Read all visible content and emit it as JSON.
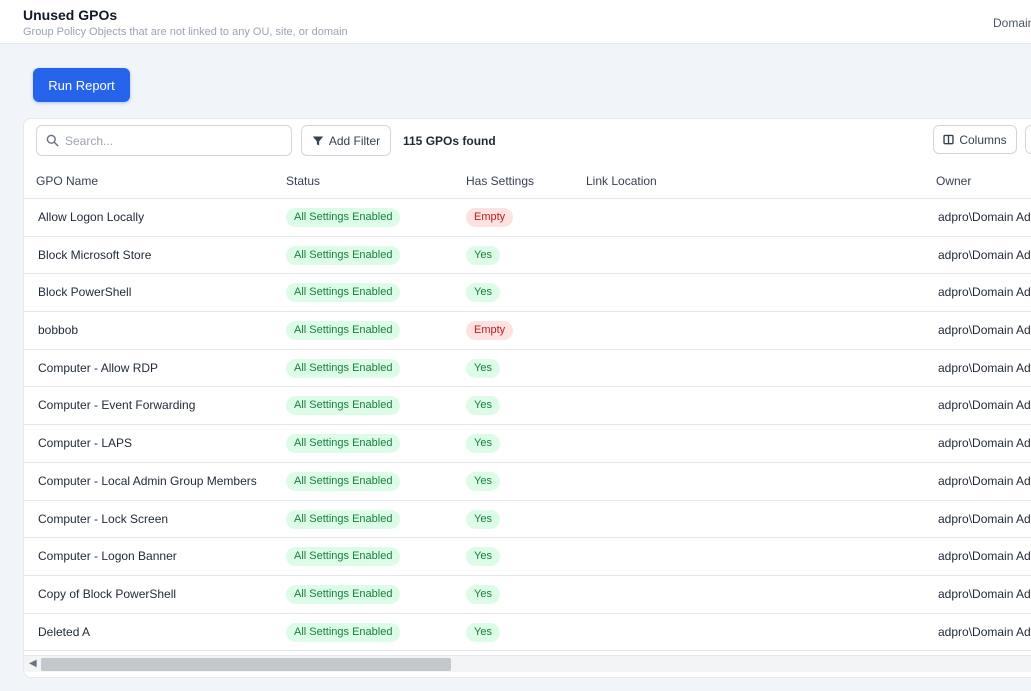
{
  "header": {
    "title": "Unused GPOs",
    "subtitle": "Group Policy Objects that are not linked to any OU, site, or domain",
    "right_label": "Domain"
  },
  "actions": {
    "run_report": "Run Report"
  },
  "toolbar": {
    "search_placeholder": "Search...",
    "add_filter": "Add Filter",
    "count_text": "115 GPOs found",
    "columns": "Columns"
  },
  "table": {
    "headers": {
      "gpo_name": "GPO Name",
      "status": "Status",
      "has_settings": "Has Settings",
      "link_location": "Link Location",
      "owner": "Owner"
    },
    "rows": [
      {
        "name": "Allow Logon Locally",
        "status": "All Settings Enabled",
        "has_settings": "Empty",
        "link_location": "",
        "owner": "adpro\\Domain Ad"
      },
      {
        "name": "Block Microsoft Store",
        "status": "All Settings Enabled",
        "has_settings": "Yes",
        "link_location": "",
        "owner": "adpro\\Domain Ad"
      },
      {
        "name": "Block PowerShell",
        "status": "All Settings Enabled",
        "has_settings": "Yes",
        "link_location": "",
        "owner": "adpro\\Domain Ad"
      },
      {
        "name": "bobbob",
        "status": "All Settings Enabled",
        "has_settings": "Empty",
        "link_location": "",
        "owner": "adpro\\Domain Ad"
      },
      {
        "name": "Computer - Allow RDP",
        "status": "All Settings Enabled",
        "has_settings": "Yes",
        "link_location": "",
        "owner": "adpro\\Domain Ad"
      },
      {
        "name": "Computer - Event Forwarding",
        "status": "All Settings Enabled",
        "has_settings": "Yes",
        "link_location": "",
        "owner": "adpro\\Domain Ad"
      },
      {
        "name": "Computer - LAPS",
        "status": "All Settings Enabled",
        "has_settings": "Yes",
        "link_location": "",
        "owner": "adpro\\Domain Ad"
      },
      {
        "name": "Computer - Local Admin Group Members",
        "status": "All Settings Enabled",
        "has_settings": "Yes",
        "link_location": "",
        "owner": "adpro\\Domain Ad"
      },
      {
        "name": "Computer - Lock Screen",
        "status": "All Settings Enabled",
        "has_settings": "Yes",
        "link_location": "",
        "owner": "adpro\\Domain Ad"
      },
      {
        "name": "Computer - Logon Banner",
        "status": "All Settings Enabled",
        "has_settings": "Yes",
        "link_location": "",
        "owner": "adpro\\Domain Ad"
      },
      {
        "name": "Copy of Block PowerShell",
        "status": "All Settings Enabled",
        "has_settings": "Yes",
        "link_location": "",
        "owner": "adpro\\Domain Ad"
      },
      {
        "name": "Deleted A",
        "status": "All Settings Enabled",
        "has_settings": "Yes",
        "link_location": "",
        "owner": "adpro\\Domain Ad"
      }
    ]
  },
  "colors": {
    "primary": "#2563eb",
    "status_green_bg": "#dcfce7",
    "status_green_text": "#15803d",
    "empty_red_bg": "#fee2e2",
    "empty_red_text": "#b91c1c"
  },
  "icons": {
    "search": "search-icon",
    "filter": "filter-icon",
    "columns": "columns-icon",
    "scroll_left": "chevron-left-icon"
  }
}
